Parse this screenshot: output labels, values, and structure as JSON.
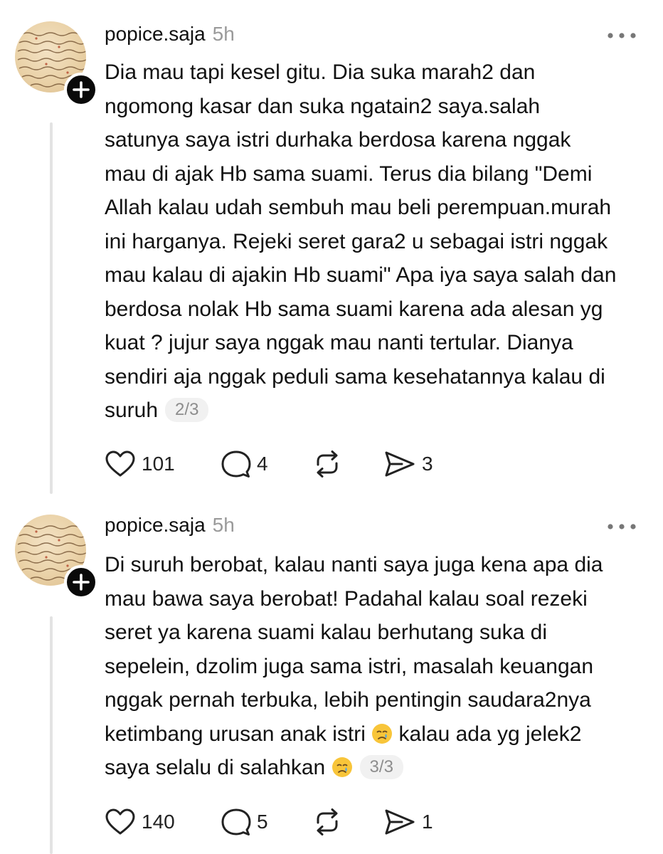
{
  "posts": [
    {
      "username": "popice.saja",
      "time": "5h",
      "text": "Dia mau tapi kesel gitu. Dia suka marah2 dan\nngomong kasar dan suka ngatain2 saya.salah\nsatunya saya istri durhaka berdosa karena nggak\nmau di ajak Hb sama suami. Terus dia bilang \"Demi\nAllah kalau udah sembuh mau beli perempuan.murah\nini harganya. Rejeki seret gara2 u sebagai istri nggak\nmau kalau di ajakin Hb suami\" Apa iya saya salah dan\nberdosa nolak Hb sama suami karena ada alesan yg\nkuat ? jujur saya nggak mau nanti tertular. Dianya\nsendiri aja nggak peduli sama kesehatannya kalau di\nsuruh",
      "page": "2/3",
      "likes": "101",
      "replies": "4",
      "shares": "3"
    },
    {
      "username": "popice.saja",
      "time": "5h",
      "text_part1": "Di suruh berobat, kalau nanti saya juga kena apa dia\nmau bawa saya berobat! Padahal kalau soal rezeki\nseret ya karena suami kalau berhutang suka di\nsepelein, dzolim juga sama istri, masalah keuangan\nnggak pernah terbuka, lebih pentingin saudara2nya\nketimbang urusan anak istri",
      "text_part2": " kalau ada yg jelek2\nsaya selalu di salahkan",
      "emoji": "crying-face",
      "page": "3/3",
      "likes": "140",
      "replies": "5",
      "shares": "1"
    }
  ],
  "icons": {
    "avatar": "manuscript-avatar",
    "follow": "plus-icon",
    "more": "more-horizontal-icon",
    "like": "heart-icon",
    "reply": "comment-icon",
    "repost": "repost-icon",
    "share": "send-icon"
  },
  "colors": {
    "text": "#111111",
    "muted": "#9a9a9a",
    "chip_bg": "#f1f1f1",
    "thread_line": "#e3e3e3"
  }
}
